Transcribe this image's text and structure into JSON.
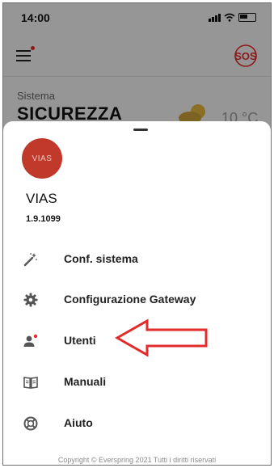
{
  "status_bar": {
    "time": "14:00"
  },
  "background": {
    "system_label": "Sistema",
    "system_value": "SICUREZZA",
    "temperature": "10 °C",
    "sos_label": "SOS"
  },
  "drawer": {
    "logo_text": "VIAS",
    "app_name": "VIAS",
    "version": "1.9.1099",
    "items": [
      {
        "label": "Conf. sistema",
        "icon": "magic-wand-icon"
      },
      {
        "label": "Configurazione Gateway",
        "icon": "gear-icon"
      },
      {
        "label": "Utenti",
        "icon": "user-icon"
      },
      {
        "label": "Manuali",
        "icon": "book-icon"
      },
      {
        "label": "Aiuto",
        "icon": "lifebuoy-icon"
      }
    ],
    "footer": "Copyright © Everspring 2021 Tutti i diritti riservati"
  },
  "colors": {
    "accent": "#e32b2b",
    "logo": "#c0392b"
  }
}
